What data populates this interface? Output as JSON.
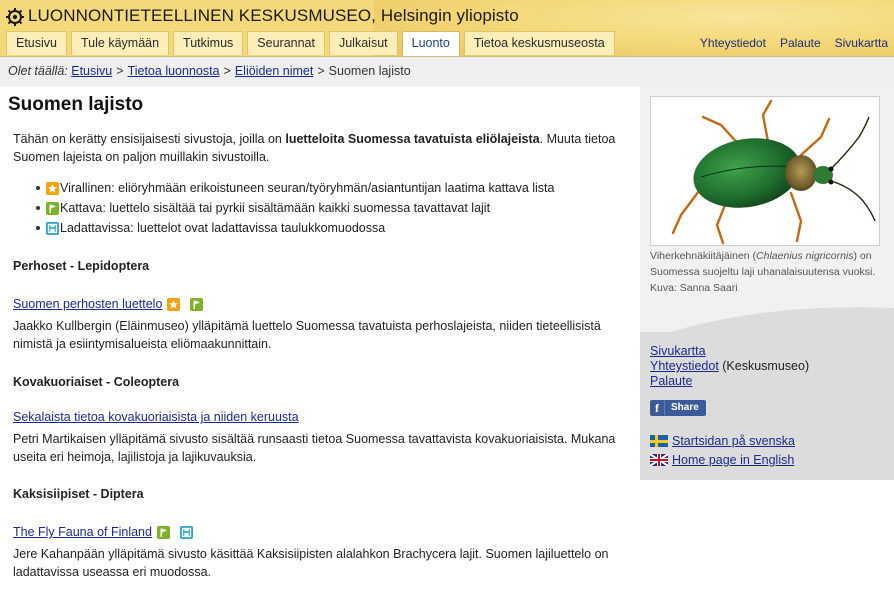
{
  "header": {
    "site_title": "LUONNONTIETEELLINEN KESKUSMUSEO, Helsingin yliopisto",
    "tabs": [
      {
        "label": "Etusivu",
        "active": false
      },
      {
        "label": "Tule käymään",
        "active": false
      },
      {
        "label": "Tutkimus",
        "active": false
      },
      {
        "label": "Seurannat",
        "active": false
      },
      {
        "label": "Julkaisut",
        "active": false
      },
      {
        "label": "Luonto",
        "active": true
      },
      {
        "label": "Tietoa keskusmuseosta",
        "active": false
      }
    ],
    "top_links": [
      "Yhteystiedot",
      "Palaute",
      "Sivukartta"
    ]
  },
  "breadcrumb": {
    "prefix": "Olet täällä:",
    "items": [
      "Etusivu",
      "Tietoa luonnosta",
      "Eliöiden nimet"
    ],
    "current": "Suomen lajisto",
    "separator": ">"
  },
  "main": {
    "title": "Suomen lajisto",
    "intro_part1": "Tähän on kerätty ensisijaisesti sivustoja, joilla on ",
    "intro_bold": "luetteloita Suomessa tavatuista eliölajeista",
    "intro_part2": ". Muuta tietoa Suomen lajeista on paljon muillakin sivustoilla.",
    "legend": [
      {
        "icon": "star-badge-icon",
        "text": "Virallinen: eliöryhmään erikoistuneen seuran/työryhmän/asiantuntijan laatima kattava lista"
      },
      {
        "icon": "flag-badge-icon",
        "text": "Kattava: luettelo sisältää tai pyrkii sisältämään kaikki suomessa tavattavat lajit"
      },
      {
        "icon": "disk-badge-icon",
        "text": "Ladattavissa: luettelot ovat ladattavissa taulukkomuodossa"
      }
    ],
    "sections": [
      {
        "title": "Perhoset - Lepidoptera",
        "link": "Suomen perhosten luettelo",
        "badges": [
          "star",
          "flag"
        ],
        "description": "Jaakko Kullbergin (Eläinmuseo) ylläpitämä luettelo Suomessa tavatuista perhoslajeista, niiden tieteellisistä nimistä ja esiintymisalueista eliömaakunnittain."
      },
      {
        "title": "Kovakuoriaiset - Coleoptera",
        "link": "Sekalaista tietoa kovakuoriaisista ja niiden keruusta",
        "badges": [],
        "description": "Petri Martikaisen ylläpitämä sivusto sisältää runsaasti tietoa Suomessa tavattavista kovakuoriaisista. Mukana useita eri heimoja, lajilistoja ja lajikuvauksia."
      },
      {
        "title": "Kaksisiipiset - Diptera",
        "link": "The Fly Fauna of Finland",
        "badges": [
          "flag",
          "disk"
        ],
        "description": "Jere Kahanpään ylläpitämä sivusto käsittää Kaksisiipisten alalahkon Brachycera lajit. Suomen lajiluettelo on ladattavissa useassa eri muodossa."
      }
    ]
  },
  "sidebar": {
    "caption_part1": "Viherkehnäkiitäjäinen (",
    "caption_italic": "Chlaenius nigricornis",
    "caption_part2": ") on Suomessa suojeltu laji uhanalaisuutensa vuoksi.",
    "caption_credit": "Kuva: Sanna Saari",
    "links": [
      "Sivukartta",
      "Yhteystiedot",
      "Palaute"
    ],
    "links_suffix": " (Keskusmuseo)",
    "share_label": "Share",
    "lang_sv": "Startsidan på svenska",
    "lang_en": "Home page in English"
  },
  "colors": {
    "header_bg": "#f4d97a",
    "link": "#1a2a8c",
    "badge_star": "#f5a20f",
    "badge_flag": "#7fb12a",
    "badge_disk": "#2ea6c8",
    "facebook": "#3b5a9a"
  }
}
